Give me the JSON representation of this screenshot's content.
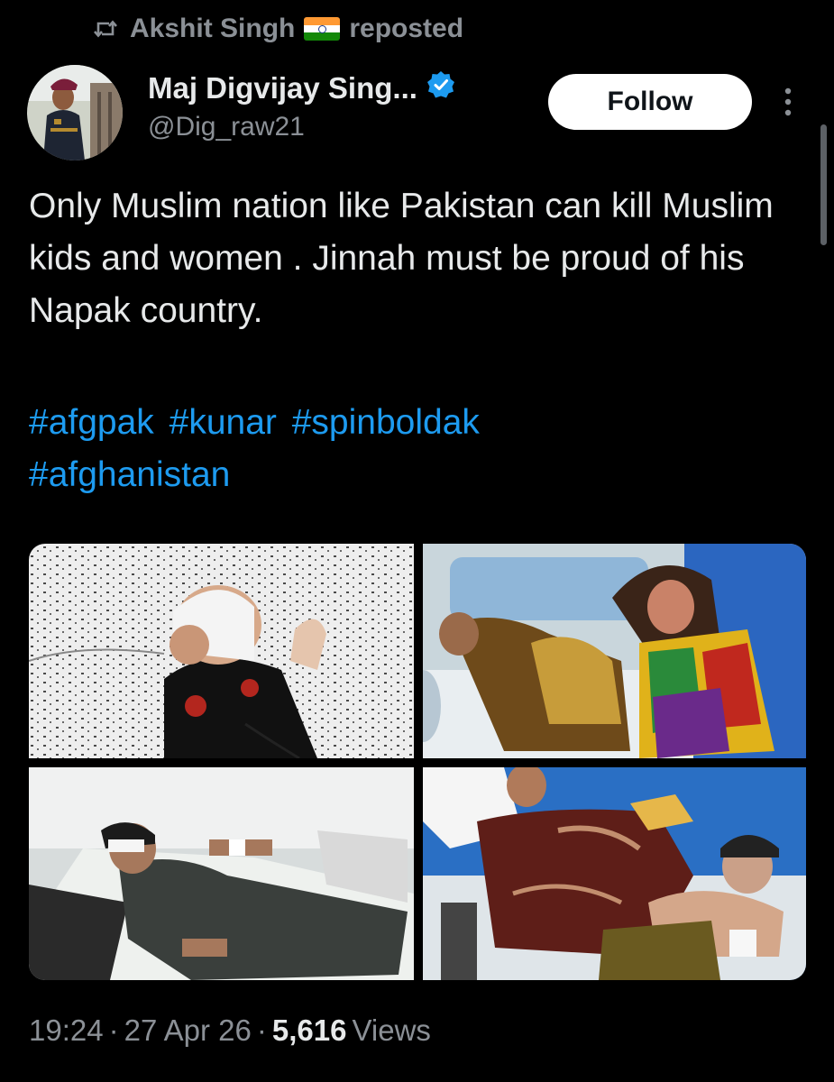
{
  "repost_header": {
    "icon": "repost-icon",
    "reposter_name": "Akshit Singh",
    "reposter_flag": "india-flag",
    "label": "reposted"
  },
  "author": {
    "display_name": "Maj Digvijay Sing...",
    "verified_icon": "verified-badge-icon",
    "handle": "@Dig_raw21",
    "avatar": "profile-photo"
  },
  "follow_button": {
    "label": "Follow"
  },
  "more_menu": {
    "icon": "more-vertical-icon"
  },
  "tweet": {
    "text": "Only Muslim nation like Pakistan can kill Muslim kids and women . Jinnah must be proud of his Napak country.",
    "hashtags": [
      "#afgpak",
      "#kunar",
      "#spinboldak",
      "#afghanistan"
    ]
  },
  "media": {
    "count": 4,
    "photos": [
      {
        "name": "photo-1"
      },
      {
        "name": "photo-2"
      },
      {
        "name": "photo-3"
      },
      {
        "name": "photo-4"
      }
    ]
  },
  "meta": {
    "time": "19:24",
    "separator": "·",
    "date": "27 Apr 26",
    "views_count": "5,616",
    "views_label": "Views"
  },
  "colors": {
    "background": "#000000",
    "text_primary": "#e7e9ea",
    "text_secondary": "#8b9096",
    "link": "#1d9bf0",
    "follow_bg": "#ffffff",
    "verified": "#1d9bf0"
  }
}
